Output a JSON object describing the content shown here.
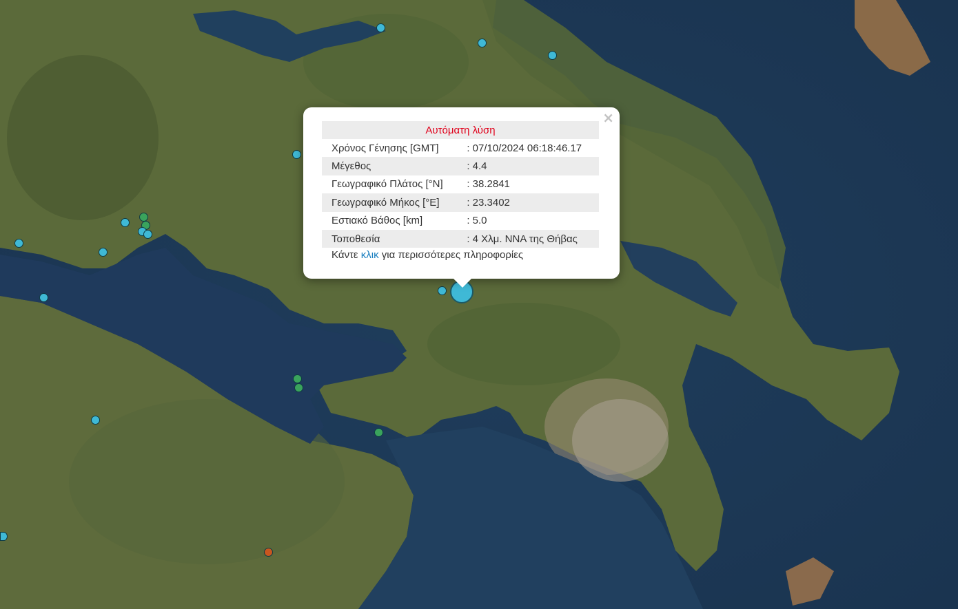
{
  "popup": {
    "title": "Αυτόματη λύση",
    "close_symbol": "×",
    "rows": [
      {
        "label": "Χρόνος Γένησης [GMT]",
        "value": ": 07/10/2024 06:18:46.17"
      },
      {
        "label": "Μέγεθος",
        "value": ": 4.4"
      },
      {
        "label": "Γεωγραφικό Πλάτος [°N]",
        "value": ": 38.2841"
      },
      {
        "label": "Γεωγραφικό Μήκος [°E]",
        "value": ": 23.3402"
      },
      {
        "label": "Εστιακό Βάθος [km]",
        "value": ": 5.0"
      },
      {
        "label": "Τοποθεσία",
        "value": ": 4 Χλμ. ΝΝΑ της Θήβας"
      }
    ],
    "more_prefix": "Κάντε ",
    "more_link": "κλικ",
    "more_suffix": " για περισσότερες πληροφορίες"
  },
  "marker_colors": {
    "recent": "#3fb9d6",
    "day": "#3aa35c",
    "older": "#c9561f"
  }
}
